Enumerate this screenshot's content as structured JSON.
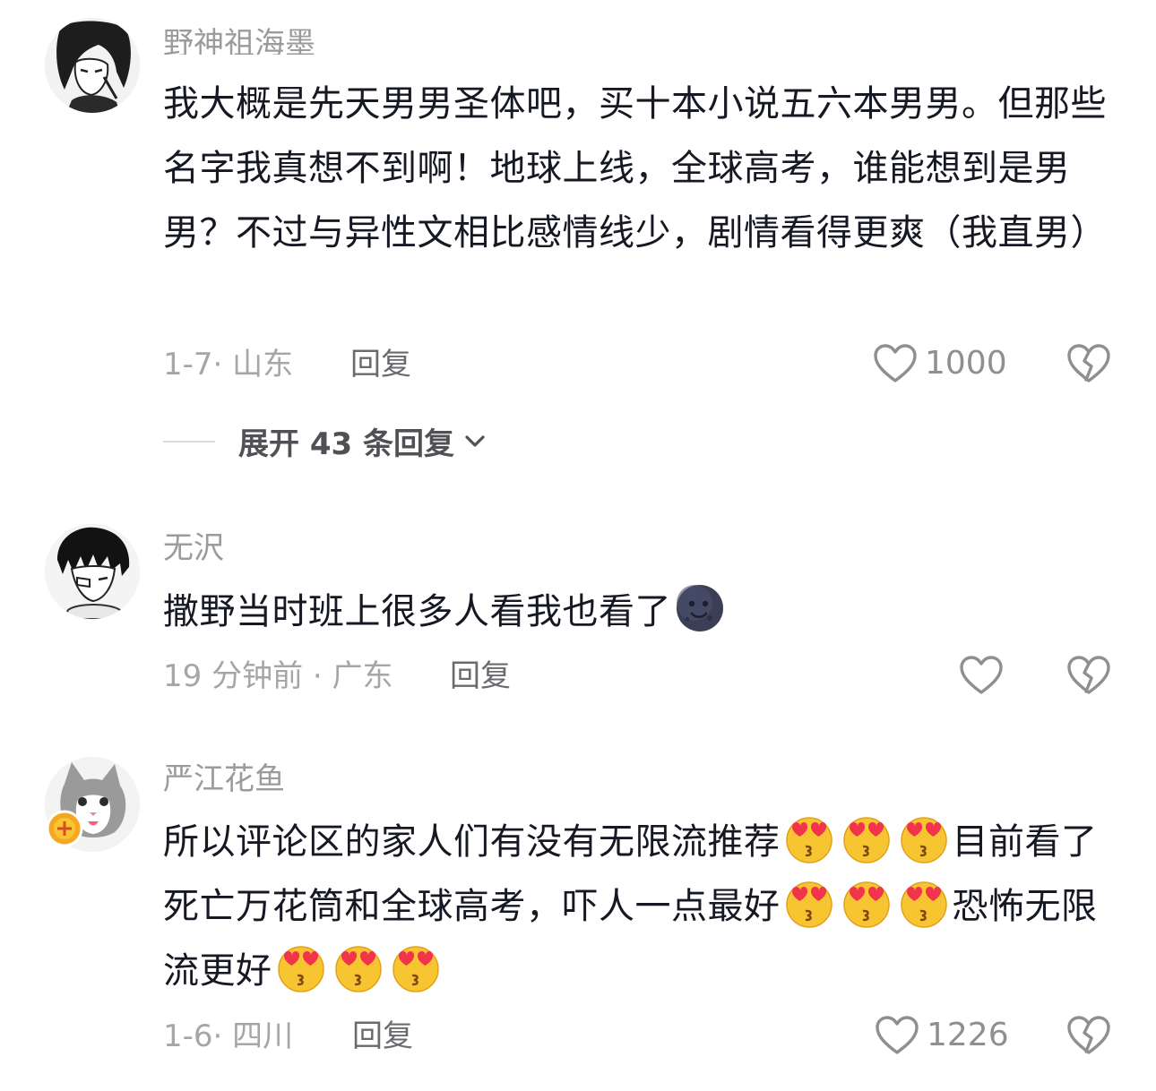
{
  "comments": [
    {
      "username": "野神祖海墨",
      "text": "我大概是先天男男圣体吧，买十本小说五六本男男。但那些名字我真想不到啊！地球上线，全球高考，谁能想到是男男？不过与异性文相比感情线少，剧情看得更爽（我直男）",
      "meta": "1-7· 山东",
      "reply_label": "回复",
      "likes": "1000",
      "expand_label": "展开 43 条回复"
    },
    {
      "username": "无沢",
      "text": "撒野当时班上很多人看我也看了",
      "emoji": "new-moon-face",
      "meta": "19 分钟前 · 广东",
      "reply_label": "回复",
      "likes": ""
    },
    {
      "username": "严江花鱼",
      "text_part1": "所以评论区的家人们有没有无限流推荐",
      "text_part2": "目前看了死亡万花筒和全球高考，吓人一点最好",
      "text_part3": "恐怖无限流更好",
      "emoji": "face-blowing-kiss-with-heart-eyes",
      "meta": "1-6· 四川",
      "reply_label": "回复",
      "likes": "1226"
    }
  ],
  "icons": {
    "like": "heart-outline-icon",
    "dislike": "broken-heart-icon",
    "expand": "chevron-down-icon"
  },
  "colors": {
    "text": "#161823",
    "meta": "#a6a6a8",
    "emoji_face": "#f7c531",
    "emoji_heart": "#f2334c"
  }
}
